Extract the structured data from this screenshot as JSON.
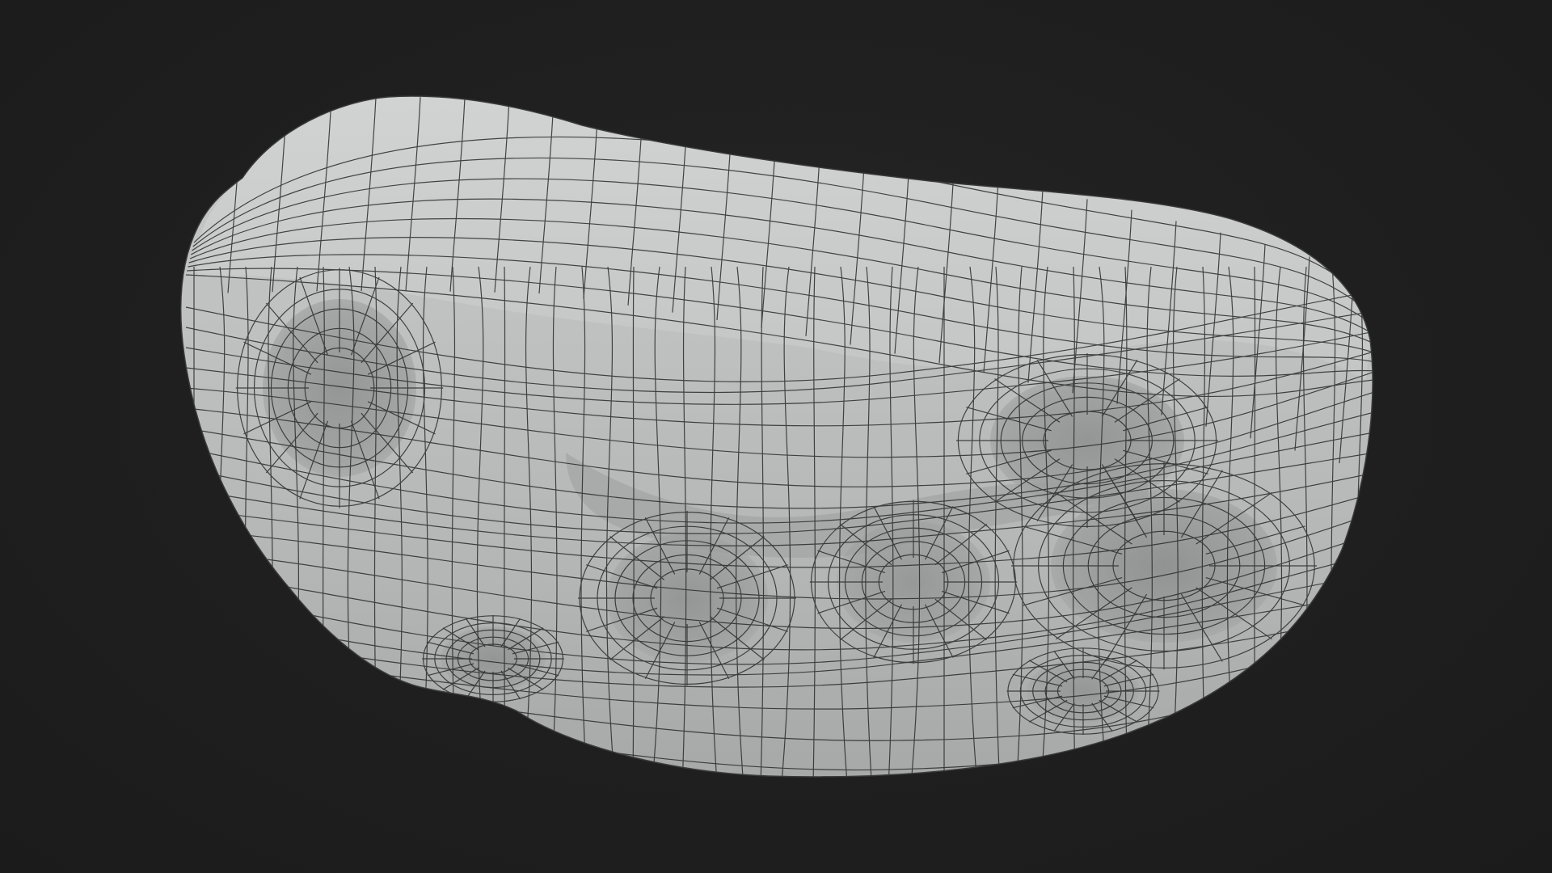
{
  "scene": {
    "background_color": "#1f1f1f",
    "surface_color": "#b9bcbc",
    "wire_color": "#2a2a2a",
    "subject": "wireframe-mesh-model"
  }
}
